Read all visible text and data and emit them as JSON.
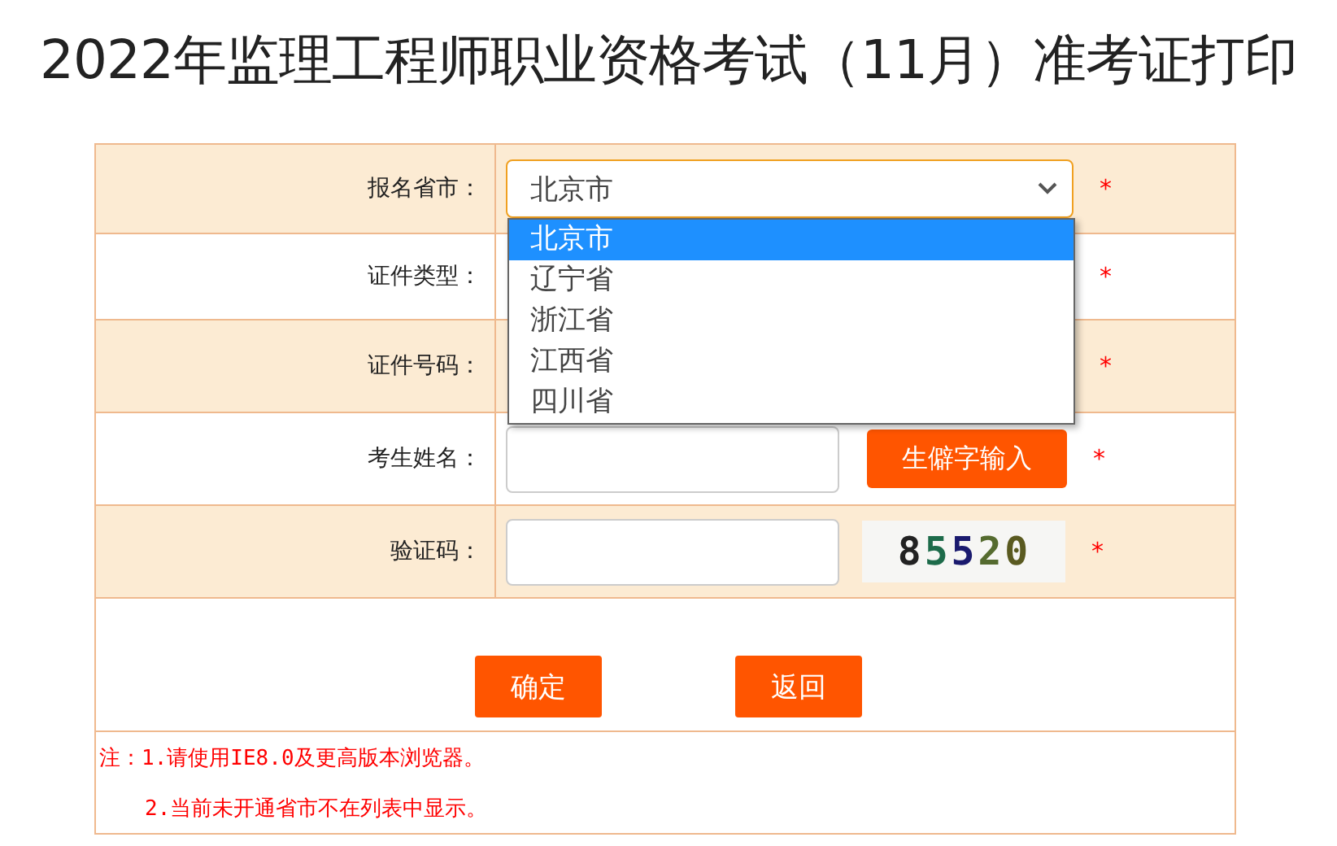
{
  "title": "2022年监理工程师职业资格考试（11月）准考证打印",
  "rows": [
    {
      "label": "报名省市：",
      "kind": "select",
      "value": "北京市",
      "mark": "*"
    },
    {
      "label": "证件类型：",
      "kind": "covered",
      "mark": "*"
    },
    {
      "label": "证件号码：",
      "kind": "covered",
      "mark": "*"
    },
    {
      "label": "考生姓名：",
      "kind": "input_button",
      "button": "生僻字输入",
      "mark": "*"
    },
    {
      "label": "验证码：",
      "kind": "input_captcha",
      "captcha": "85520",
      "mark": "*"
    }
  ],
  "dropdown": {
    "expanded": true,
    "options": [
      {
        "label": "北京市",
        "selected": true
      },
      {
        "label": "辽宁省",
        "selected": false
      },
      {
        "label": "浙江省",
        "selected": false
      },
      {
        "label": "江西省",
        "selected": false
      },
      {
        "label": "四川省",
        "selected": false
      }
    ]
  },
  "buttons": [
    "确定",
    "返回"
  ],
  "notes": [
    "注：1.请使用IE8.0及更高版本浏览器。",
    "2.当前未开通省市不在列表中显示。"
  ]
}
